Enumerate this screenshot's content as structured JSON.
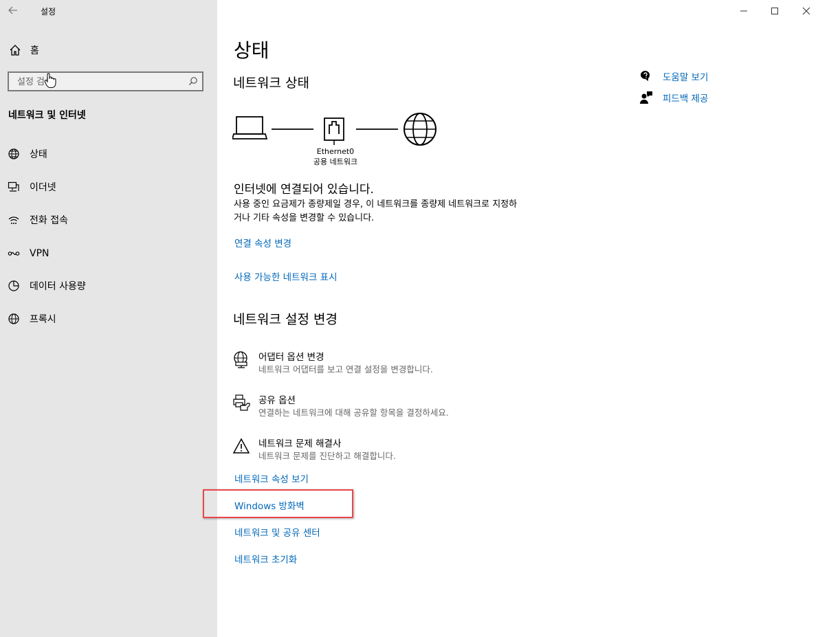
{
  "window": {
    "title": "설정",
    "back_icon": "back-arrow-icon",
    "controls": [
      "minimize-icon",
      "maximize-icon",
      "close-icon"
    ]
  },
  "sidebar": {
    "home_label": "홈",
    "search": {
      "placeholder": "설정 검색",
      "value": "설정 검색"
    },
    "section_title": "네트워크 및 인터넷",
    "items": [
      {
        "label": "상태",
        "icon": "status-globe-icon"
      },
      {
        "label": "이더넷",
        "icon": "ethernet-icon"
      },
      {
        "label": "전화 접속",
        "icon": "dialup-icon"
      },
      {
        "label": "VPN",
        "icon": "vpn-icon"
      },
      {
        "label": "데이터 사용량",
        "icon": "data-usage-icon"
      },
      {
        "label": "프록시",
        "icon": "proxy-globe-icon"
      }
    ]
  },
  "main": {
    "title": "상태",
    "network_status": {
      "heading": "네트워크 상태",
      "adapter_name": "Ethernet0",
      "network_profile": "공용 네트워크",
      "connected_text": "인터넷에 연결되어 있습니다.",
      "description": "사용 중인 요금제가 종량제일 경우, 이 네트워크를 종량제 네트워크로 지정하거나 기타 속성을 변경할 수 있습니다.",
      "link_connection_properties": "연결 속성 변경",
      "link_available_networks": "사용 가능한 네트워크 표시"
    },
    "change_settings": {
      "heading": "네트워크 설정 변경",
      "options": [
        {
          "title": "어댑터 옵션 변경",
          "desc": "네트워크 어댑터를 보고 연결 설정을 변경합니다.",
          "icon": "adapter-globe-icon"
        },
        {
          "title": "공유 옵션",
          "desc": "연결하는 네트워크에 대해 공유할 항목을 결정하세요.",
          "icon": "sharing-printer-icon"
        },
        {
          "title": "네트워크 문제 해결사",
          "desc": "네트워크 문제를 진단하고 해결합니다.",
          "icon": "warning-icon"
        }
      ],
      "links": {
        "view_properties": "네트워크 속성 보기",
        "windows_firewall": "Windows 방화벽",
        "sharing_center": "네트워크 및 공유 센터",
        "network_reset": "네트워크 초기화"
      }
    },
    "help": {
      "get_help": "도움말 보기",
      "feedback": "피드백 제공"
    }
  },
  "colors": {
    "link": "#0067b8",
    "sidebar_bg": "#e6e6e6",
    "highlight": "#e8484a"
  }
}
